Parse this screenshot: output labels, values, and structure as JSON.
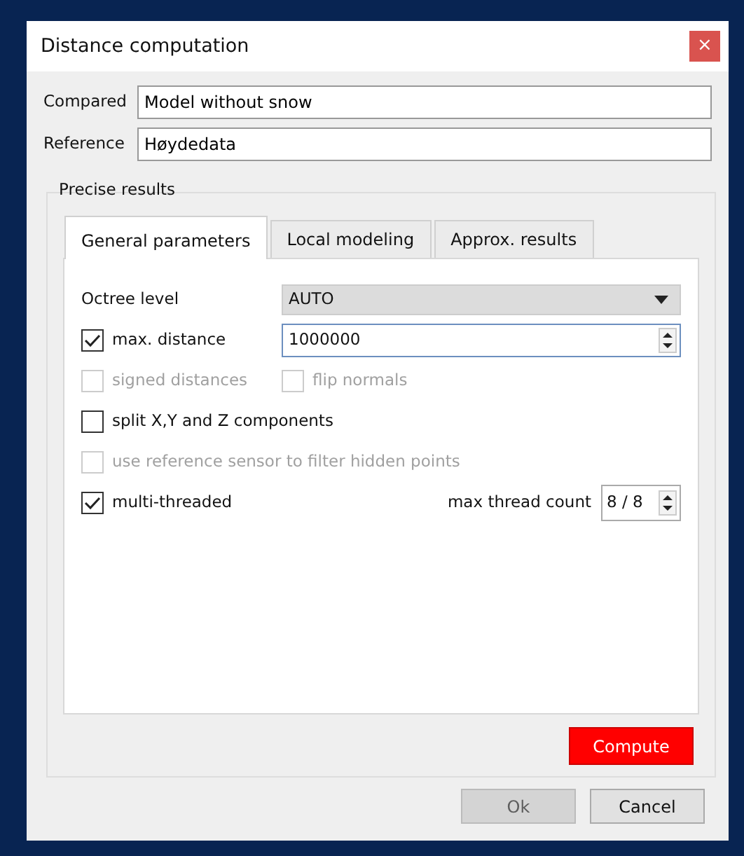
{
  "window": {
    "title": "Distance computation",
    "close": "×"
  },
  "fields": [
    {
      "label": "Compared",
      "value": "Model without snow"
    },
    {
      "label": "Reference",
      "value": "Høydedata"
    }
  ],
  "group": {
    "title": "Precise results",
    "tabs": [
      {
        "label": "General parameters",
        "selected": true
      },
      {
        "label": "Local modeling",
        "selected": false
      },
      {
        "label": "Approx. results",
        "selected": false
      }
    ],
    "octree": {
      "label": "Octree level",
      "value": "AUTO"
    },
    "max_distance": {
      "label": "max. distance",
      "checked": true,
      "disabled": false,
      "value": "1000000"
    },
    "option_rows": [
      [
        {
          "label": "signed distances",
          "checked": false,
          "disabled": true
        },
        {
          "label": "flip normals",
          "checked": false,
          "disabled": true
        }
      ],
      [
        {
          "label": "split X,Y and Z components",
          "checked": false,
          "disabled": false
        }
      ],
      [
        {
          "label": "use reference sensor to filter hidden points",
          "checked": false,
          "disabled": true
        }
      ]
    ],
    "multi_threaded": {
      "label": "multi-threaded",
      "checked": true,
      "disabled": false,
      "count_label": "max thread count",
      "count_value": "8 / 8"
    },
    "compute": "Compute"
  },
  "buttons": [
    {
      "label": "Ok",
      "disabled": true
    },
    {
      "label": "Cancel",
      "disabled": false
    }
  ]
}
